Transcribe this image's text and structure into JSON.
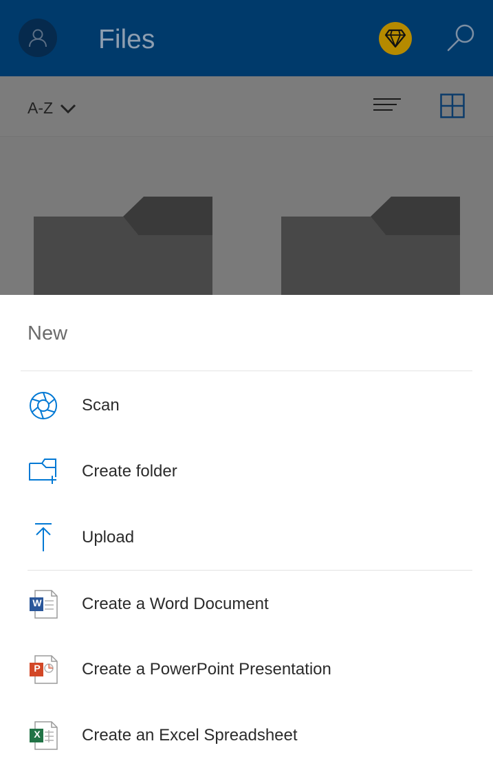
{
  "header": {
    "title": "Files",
    "icons": {
      "account": "person-icon",
      "premium": "diamond-icon",
      "search": "search-icon"
    }
  },
  "sortbar": {
    "sort_label": "A-Z",
    "icons": {
      "dropdown": "chevron-down-icon",
      "list": "list-view-icon",
      "grid": "grid-view-icon"
    }
  },
  "folders": [
    {
      "icon": "folder-icon"
    },
    {
      "icon": "folder-icon"
    }
  ],
  "sheet": {
    "title": "New",
    "items": [
      {
        "label": "Scan",
        "icon": "camera-aperture-icon"
      },
      {
        "label": "Create folder",
        "icon": "folder-add-icon"
      },
      {
        "label": "Upload",
        "icon": "upload-icon"
      },
      {
        "label": "Create a Word Document",
        "icon": "word-doc-icon",
        "badge": "W"
      },
      {
        "label": "Create a PowerPoint Presentation",
        "icon": "powerpoint-doc-icon",
        "badge": "P"
      },
      {
        "label": "Create an Excel Spreadsheet",
        "icon": "excel-doc-icon",
        "badge": "X"
      }
    ]
  },
  "colors": {
    "header": "#003a6b",
    "accent": "#0078d4",
    "premium": "#b58a00",
    "word": "#2b579a",
    "powerpoint": "#d24726",
    "excel": "#217346"
  }
}
